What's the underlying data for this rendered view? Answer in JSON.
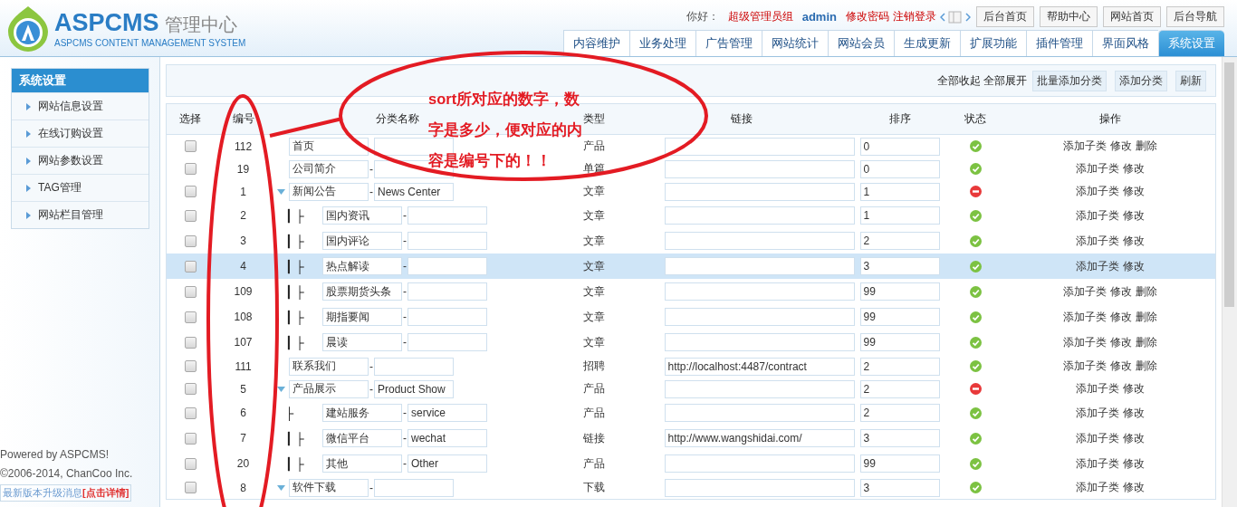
{
  "header": {
    "logo_title": "ASPCMS",
    "logo_suffix": "管理中心",
    "logo_subtitle": "ASPCMS CONTENT MANAGEMENT SYSTEM",
    "greeting": "你好：",
    "user_group": "超级管理员组",
    "username": "admin",
    "links": [
      "修改密码",
      "注销登录"
    ],
    "buttons": [
      "后台首页",
      "帮助中心",
      "网站首页",
      "后台导航"
    ],
    "tabs": [
      {
        "label": "内容维护",
        "selected": false
      },
      {
        "label": "业务处理",
        "selected": false
      },
      {
        "label": "广告管理",
        "selected": false
      },
      {
        "label": "网站统计",
        "selected": false
      },
      {
        "label": "网站会员",
        "selected": false
      },
      {
        "label": "生成更新",
        "selected": false
      },
      {
        "label": "扩展功能",
        "selected": false
      },
      {
        "label": "插件管理",
        "selected": false
      },
      {
        "label": "界面风格",
        "selected": false
      },
      {
        "label": "系统设置",
        "selected": true
      }
    ]
  },
  "sidebar": {
    "title": "系统设置",
    "items": [
      "网站信息设置",
      "在线订购设置",
      "网站参数设置",
      "TAG管理",
      "网站栏目管理"
    ],
    "footer": {
      "powered": "Powered by ASPCMS!",
      "copyright": "©2006-2014, ChanCoo Inc.",
      "notice": "最新版本升级消息",
      "notice_link": "[点击详情]"
    }
  },
  "toolbar": {
    "links": [
      "全部收起",
      "全部展开"
    ],
    "buttons": [
      "批量添加分类",
      "添加分类",
      "刷新"
    ]
  },
  "table": {
    "columns": [
      "选择",
      "编号",
      "分类名称",
      "类型",
      "链接",
      "排序",
      "状态",
      "操作"
    ],
    "rows": [
      {
        "id": "112",
        "name": "首页",
        "type": "产品",
        "sort": "0",
        "enabled": true,
        "checked": false,
        "selected": false,
        "actions": [
          "添加子类",
          "修改",
          "删除"
        ]
      },
      {
        "id": "19",
        "name": "公司简介",
        "separator": "-",
        "type": "单篇",
        "sort": "0",
        "enabled": true,
        "checked": false,
        "selected": false,
        "actions": [
          "添加子类",
          "修改"
        ]
      },
      {
        "id": "1",
        "name": "新闻公告",
        "separator": "-",
        "en_name": "News Center",
        "type": "文章",
        "sort": "1",
        "enabled": false,
        "checked": false,
        "selected": false,
        "expanded": true,
        "actions": [
          "添加子类",
          "修改"
        ],
        "children": [
          {
            "id": "2",
            "prefix": "┃ ├",
            "name": "国内资讯",
            "separator": "-",
            "type": "文章",
            "sort": "1",
            "enabled": true,
            "checked": false,
            "selected": false,
            "actions": [
              "添加子类",
              "修改"
            ]
          },
          {
            "id": "3",
            "prefix": "┃ ├",
            "name": "国内评论",
            "separator": "-",
            "type": "文章",
            "sort": "2",
            "enabled": true,
            "checked": false,
            "selected": false,
            "actions": [
              "添加子类",
              "修改"
            ]
          },
          {
            "id": "4",
            "prefix": "┃ ├",
            "name": "热点解读",
            "separator": "-",
            "type": "文章",
            "sort": "3",
            "enabled": true,
            "checked": false,
            "selected": true,
            "actions": [
              "添加子类",
              "修改"
            ]
          },
          {
            "id": "109",
            "prefix": "┃ ├",
            "name": "股票期货头条",
            "separator": "-",
            "type": "文章",
            "sort": "99",
            "enabled": true,
            "checked": false,
            "selected": false,
            "actions": [
              "添加子类",
              "修改",
              "删除"
            ]
          },
          {
            "id": "108",
            "prefix": "┃ ├",
            "name": "期指要闻",
            "separator": "-",
            "type": "文章",
            "sort": "99",
            "enabled": true,
            "checked": false,
            "selected": false,
            "actions": [
              "添加子类",
              "修改",
              "删除"
            ]
          },
          {
            "id": "107",
            "prefix": "┃ ├",
            "name": "晨读",
            "separator": "-",
            "type": "文章",
            "sort": "99",
            "enabled": true,
            "checked": false,
            "selected": false,
            "actions": [
              "添加子类",
              "修改",
              "删除"
            ]
          }
        ]
      },
      {
        "id": "111",
        "name": "联系我们",
        "separator": "-",
        "type": "招聘",
        "link": "http://localhost:4487/contract",
        "sort": "2",
        "enabled": true,
        "checked": false,
        "selected": false,
        "actions": [
          "添加子类",
          "修改",
          "删除"
        ]
      },
      {
        "id": "5",
        "name": "产品展示",
        "separator": "-",
        "en_name": "Product Show",
        "type": "产品",
        "sort": "2",
        "enabled": false,
        "checked": false,
        "selected": false,
        "expanded": true,
        "actions": [
          "添加子类",
          "修改"
        ],
        "children": [
          {
            "id": "6",
            "prefix": "├",
            "name": "建站服务",
            "separator": "-",
            "en_name": "service",
            "type": "产品",
            "sort": "2",
            "enabled": true,
            "checked": false,
            "selected": false,
            "actions": [
              "添加子类",
              "修改"
            ]
          },
          {
            "id": "7",
            "prefix": "┃ ├",
            "name": "微信平台",
            "separator": "-",
            "en_name": "wechat",
            "type": "链接",
            "link": "http://www.wangshidai.com/",
            "sort": "3",
            "enabled": true,
            "checked": false,
            "selected": false,
            "actions": [
              "添加子类",
              "修改"
            ]
          },
          {
            "id": "20",
            "prefix": "┃ ├",
            "name": "其他",
            "separator": "-",
            "en_name": "Other",
            "type": "产品",
            "sort": "99",
            "enabled": true,
            "checked": false,
            "selected": false,
            "actions": [
              "添加子类",
              "修改"
            ]
          }
        ]
      },
      {
        "id": "8",
        "name": "软件下载",
        "separator": "-",
        "type": "下载",
        "sort": "3",
        "enabled": true,
        "checked": false,
        "selected": false,
        "expanded": true,
        "actions": [
          "添加子类",
          "修改"
        ]
      }
    ]
  },
  "annotation": {
    "lines": [
      "sort所对应的数字，数",
      "字是多少，便对应的内",
      "容是编号下的！！"
    ]
  }
}
